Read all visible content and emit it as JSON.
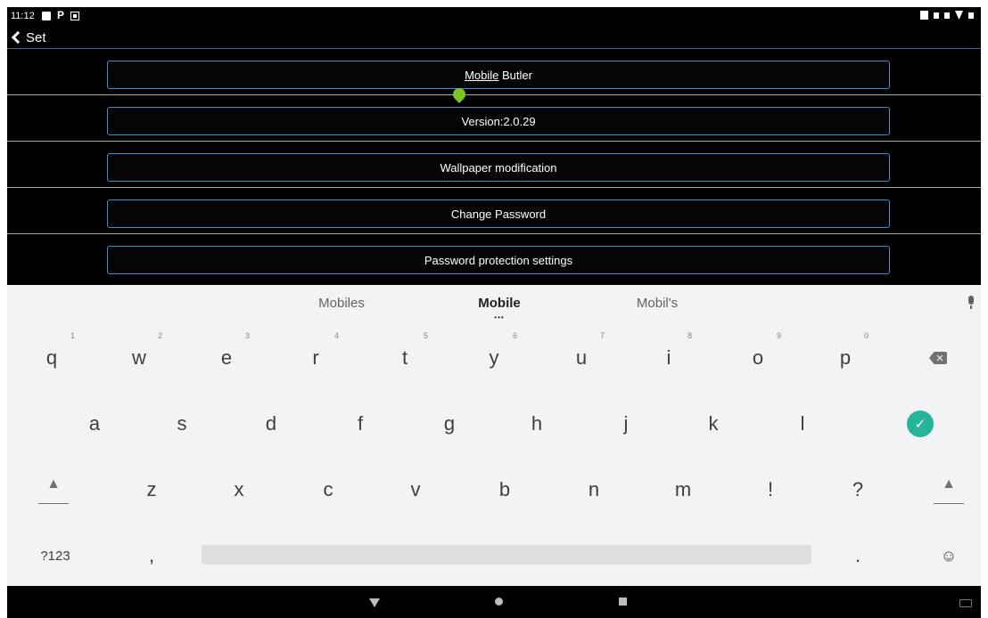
{
  "status_bar": {
    "time": "11:12",
    "notification_icons": [
      "image-icon",
      "p-icon",
      "barcode-icon"
    ],
    "right_icons": [
      "phone-icon",
      "mute-icon",
      "vibrate-icon",
      "wifi-icon",
      "battery-icon"
    ],
    "p_glyph": "P"
  },
  "app_bar": {
    "back_icon": "chevron-left-icon",
    "title": "Set"
  },
  "settings": {
    "items": [
      {
        "label_part1": "Mobile",
        "label_part2": " Butler"
      },
      {
        "label": "Version:2.0.29"
      },
      {
        "label": "Wallpaper modification"
      },
      {
        "label": "Change Password"
      },
      {
        "label": "Password protection settings"
      }
    ],
    "accent_color": "#3a8fd0"
  },
  "keyboard": {
    "suggestions": [
      "Mobiles",
      "Mobile",
      "Mobil's"
    ],
    "suggestion_more": "•••",
    "row1": [
      {
        "key": "q",
        "hint": "1"
      },
      {
        "key": "w",
        "hint": "2"
      },
      {
        "key": "e",
        "hint": "3"
      },
      {
        "key": "r",
        "hint": "4"
      },
      {
        "key": "t",
        "hint": "5"
      },
      {
        "key": "y",
        "hint": "6"
      },
      {
        "key": "u",
        "hint": "7"
      },
      {
        "key": "i",
        "hint": "8"
      },
      {
        "key": "o",
        "hint": "9"
      },
      {
        "key": "p",
        "hint": "0"
      }
    ],
    "row2": [
      "a",
      "s",
      "d",
      "f",
      "g",
      "h",
      "j",
      "k",
      "l"
    ],
    "row3": [
      "z",
      "x",
      "c",
      "v",
      "b",
      "n",
      "m",
      "!",
      "?"
    ],
    "symbols_key": "?123",
    "comma_key": ",",
    "period_key": ".",
    "enter_glyph": "✓",
    "delete_glyph": "✕",
    "shift_glyph": "▲",
    "emoji_glyph": "☺",
    "enter_color": "#26b59a"
  },
  "nav_bar": {
    "buttons": [
      "back-triangle-icon",
      "home-circle-icon",
      "recents-square-icon"
    ]
  }
}
